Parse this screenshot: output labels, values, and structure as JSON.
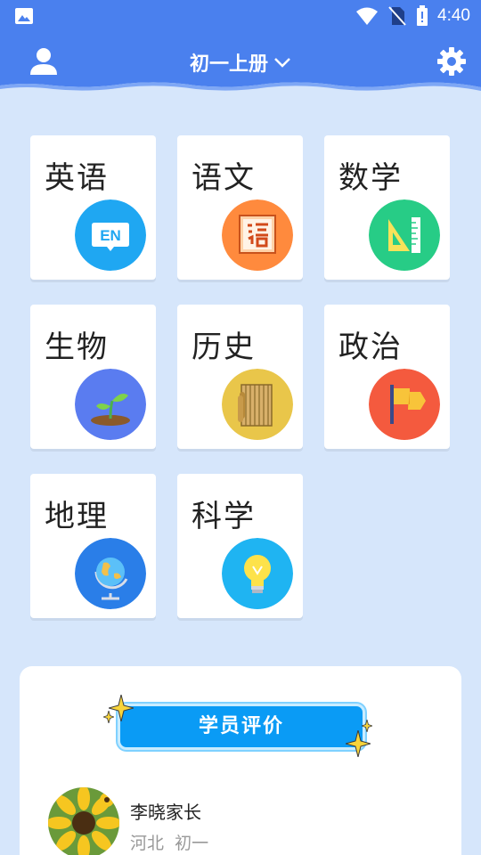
{
  "status_bar": {
    "time": "4:40",
    "icons": [
      "image-icon",
      "wifi-icon",
      "no-sim-icon",
      "battery-icon"
    ]
  },
  "header": {
    "grade": "初一上册",
    "user_icon": "user-icon",
    "settings_icon": "gear-icon"
  },
  "subjects": [
    {
      "label": "英语",
      "icon": "en-icon",
      "color": "#1fa7f2"
    },
    {
      "label": "语文",
      "icon": "chinese-char-icon",
      "color": "#ff8a3d"
    },
    {
      "label": "数学",
      "icon": "ruler-triangle-icon",
      "color": "#27cc86"
    },
    {
      "label": "生物",
      "icon": "sprout-icon",
      "color": "#5a7cf0"
    },
    {
      "label": "历史",
      "icon": "bamboo-scroll-icon",
      "color": "#e9c64a"
    },
    {
      "label": "政治",
      "icon": "flag-icon",
      "color": "#f45a3e"
    },
    {
      "label": "地理",
      "icon": "globe-icon",
      "color": "#2a7ee8"
    },
    {
      "label": "科学",
      "icon": "lightbulb-icon",
      "color": "#1fb4f2"
    }
  ],
  "reviews": {
    "title": "学员评价",
    "items": [
      {
        "name": "李晓家长",
        "region": "河北",
        "grade": "初一"
      }
    ]
  },
  "colors": {
    "header": "#4a80ee",
    "background": "#d6e6fb",
    "review_button": "#0a9bf5"
  }
}
